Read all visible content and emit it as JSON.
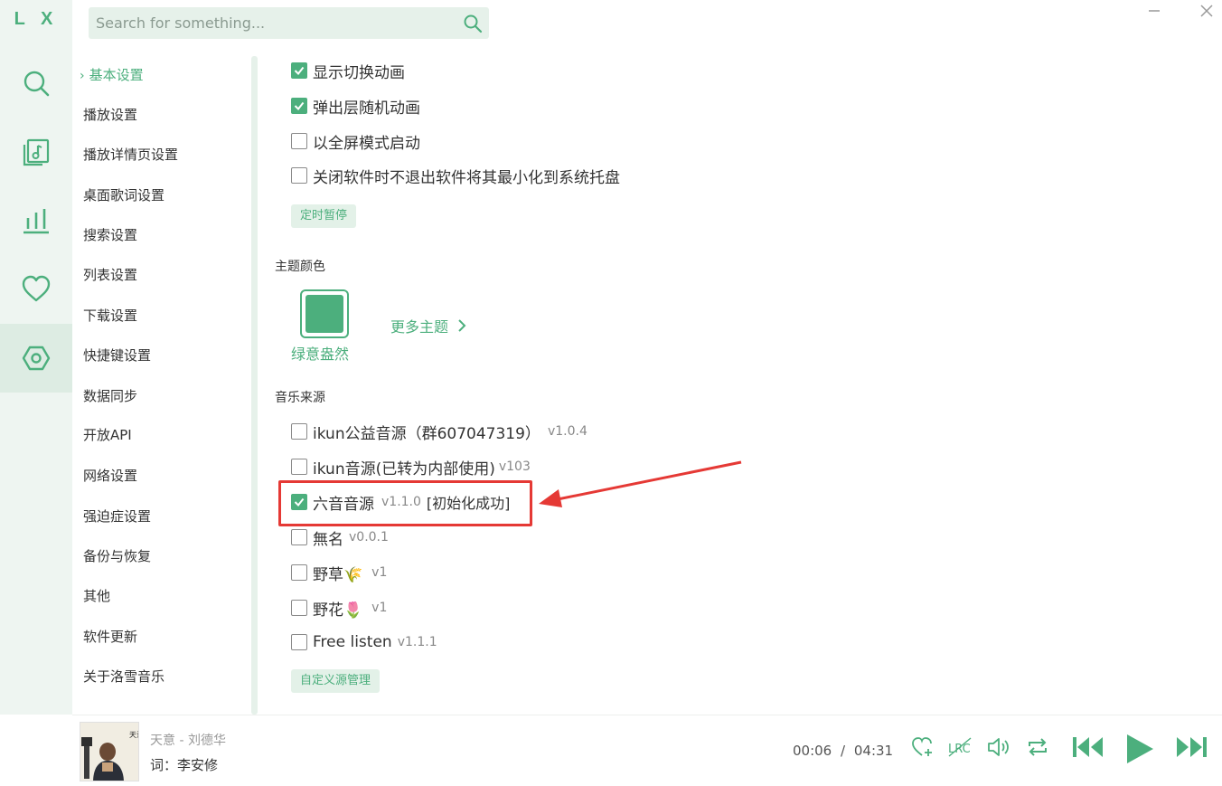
{
  "app": {
    "logo": "L X"
  },
  "search": {
    "placeholder": "Search for something..."
  },
  "rail": {
    "items": [
      {
        "icon": "search-icon"
      },
      {
        "icon": "music-list-icon"
      },
      {
        "icon": "leaderboard-icon"
      },
      {
        "icon": "heart-icon"
      },
      {
        "icon": "settings-icon",
        "active": true
      }
    ]
  },
  "nav": {
    "items": [
      {
        "label": "基本设置",
        "active": true
      },
      {
        "label": "播放设置"
      },
      {
        "label": "播放详情页设置"
      },
      {
        "label": "桌面歌词设置"
      },
      {
        "label": "搜索设置"
      },
      {
        "label": "列表设置"
      },
      {
        "label": "下载设置"
      },
      {
        "label": "快捷键设置"
      },
      {
        "label": "数据同步"
      },
      {
        "label": "开放API"
      },
      {
        "label": "网络设置"
      },
      {
        "label": "强迫症设置"
      },
      {
        "label": "备份与恢复"
      },
      {
        "label": "其他"
      },
      {
        "label": "软件更新"
      },
      {
        "label": "关于洛雪音乐"
      }
    ]
  },
  "basic": {
    "options": [
      {
        "label": "显示切换动画",
        "checked": true
      },
      {
        "label": "弹出层随机动画",
        "checked": true
      },
      {
        "label": "以全屏模式启动",
        "checked": false
      },
      {
        "label": "关闭软件时不退出软件将其最小化到系统托盘",
        "checked": false
      }
    ],
    "timer_button": "定时暂停"
  },
  "theme": {
    "title": "主题颜色",
    "current": "绿意盎然",
    "more": "更多主题",
    "color": "#4caf7d"
  },
  "sources": {
    "title": "音乐来源",
    "items": [
      {
        "name": "ikun公益音源（群607047319）",
        "version": "v1.0.4",
        "checked": false
      },
      {
        "name": "ikun音源(已转为内部使用)",
        "version": "v103",
        "checked": false
      },
      {
        "name": "六音音源",
        "version": "v1.1.0",
        "status": "[初始化成功]",
        "checked": true
      },
      {
        "name": "無名",
        "version": "v0.0.1",
        "checked": false
      },
      {
        "name": "野草🌾",
        "version": "v1",
        "checked": false
      },
      {
        "name": "野花🌷",
        "version": "v1",
        "checked": false
      },
      {
        "name": "Free listen",
        "version": "v1.1.1",
        "checked": false
      }
    ],
    "manage_button": "自定义源管理"
  },
  "player": {
    "song": "天意 - 刘德华",
    "lyric": "词：李安修",
    "time_current": "00:06",
    "time_sep": "/",
    "time_total": "04:31",
    "cover_text": "天意"
  },
  "colors": {
    "accent": "#4caf7d",
    "highlight": "#e53935"
  }
}
